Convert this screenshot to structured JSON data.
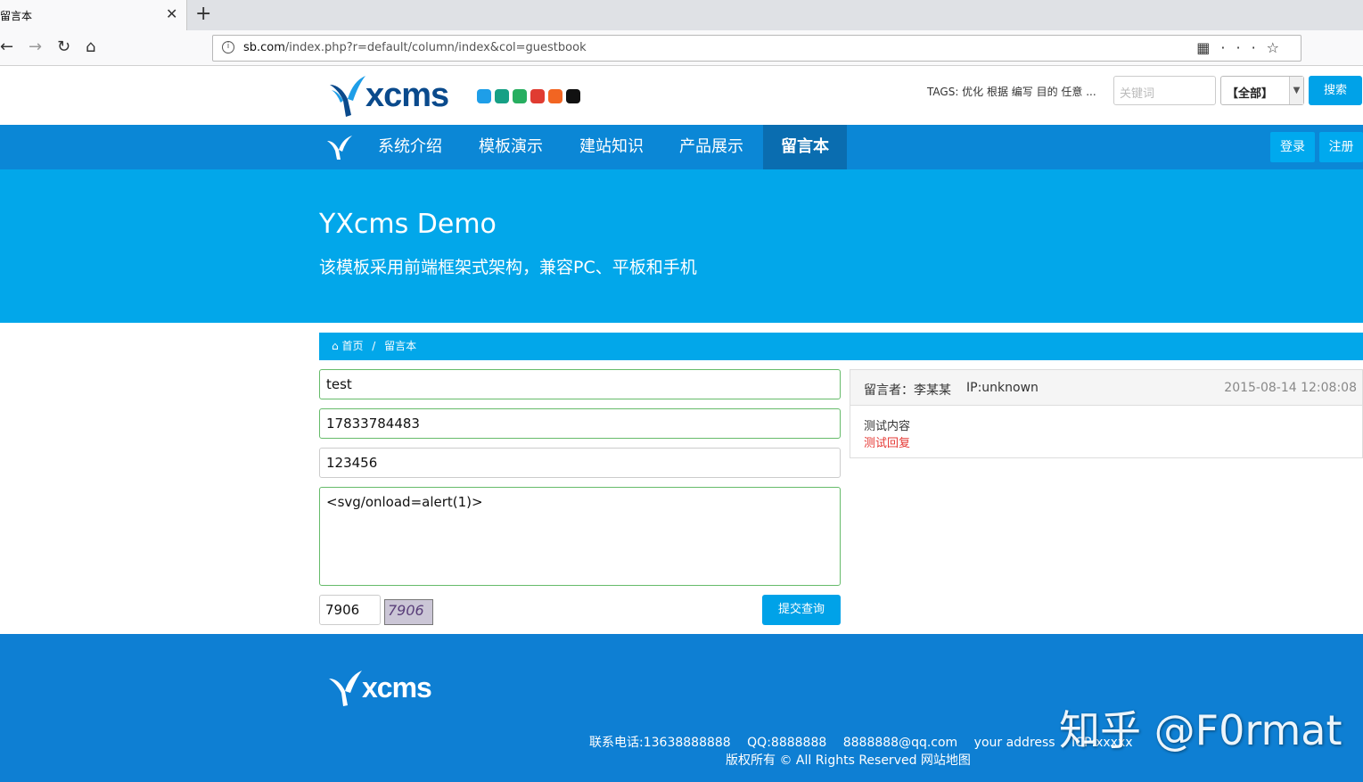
{
  "browser": {
    "tab_title": "留言本",
    "tab_close": "✕",
    "new_tab": "+",
    "url_host": "sb.com",
    "url_path": "/index.php?r=default/column/index&col=guestbook",
    "back": "←",
    "forward": "→",
    "reload": "↻",
    "home": "⌂"
  },
  "header": {
    "logo_text": "xcms",
    "swatch_colors": [
      "#1e9ee8",
      "#16a085",
      "#27ae60",
      "#e03c31",
      "#f26522",
      "#111111"
    ],
    "tags_label": "TAGS: 优化 根据 编写 目的 任意 ...",
    "search_placeholder": "关键词",
    "search_scope": "【全部】",
    "search_button": "搜索"
  },
  "nav": {
    "items": [
      "系统介绍",
      "模板演示",
      "建站知识",
      "产品展示",
      "留言本"
    ],
    "active_index": 4,
    "login": "登录",
    "register": "注册"
  },
  "hero": {
    "title": "YXcms Demo",
    "subtitle": "该模板采用前端框架式架构，兼容PC、平板和手机"
  },
  "breadcrumb": {
    "home": "首页",
    "separator": "/",
    "current": "留言本"
  },
  "form": {
    "name_value": "test",
    "phone_value": "17833784483",
    "third_value": "123456",
    "content_value": "<svg/onload=alert(1)>",
    "captcha_value": "7906",
    "captcha_image_text": "7906",
    "submit_label": "提交查询"
  },
  "message": {
    "author": "留言者：李某某",
    "ip": "IP:unknown",
    "date": "2015-08-14 12:08:08",
    "content": "测试内容",
    "reply": "测试回复"
  },
  "footer": {
    "logo_text": "xcms",
    "phone": "联系电话:13638888888",
    "qq": "QQ:8888888",
    "email": "8888888@qq.com",
    "address": "your address",
    "icp": "ICP:xxxxx",
    "copyright": "版权所有 © All Rights Reserved 网站地图"
  },
  "watermark": "知乎 @F0rmat"
}
